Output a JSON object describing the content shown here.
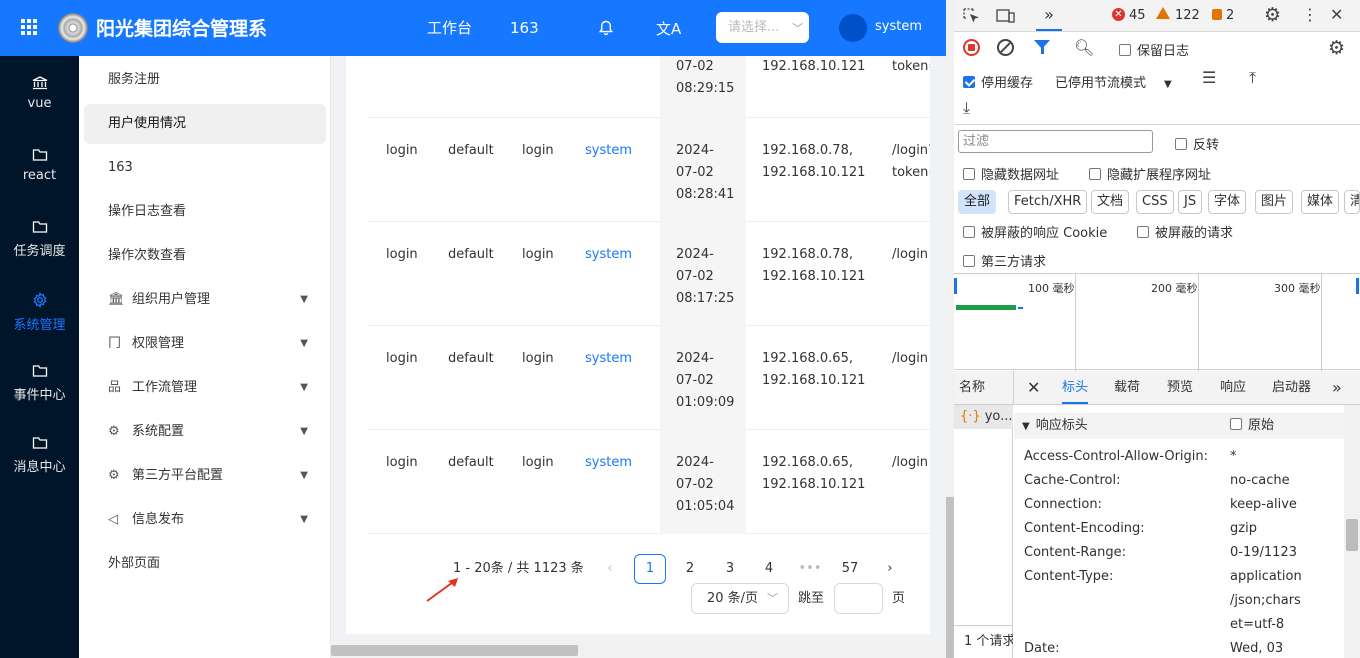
{
  "header": {
    "app_title": "阳光集团综合管理系统",
    "workspace": "工作台",
    "shortcut": "163",
    "select_placeholder": "请选择...",
    "username": "system"
  },
  "leftnav": {
    "items": [
      {
        "label": "vue",
        "icon": "bank-icon"
      },
      {
        "label": "react",
        "icon": "folder-icon"
      },
      {
        "label": "任务调度",
        "icon": "folder-icon"
      },
      {
        "label": "系统管理",
        "icon": "gear-icon"
      },
      {
        "label": "事件中心",
        "icon": "folder-icon"
      },
      {
        "label": "消息中心",
        "icon": "folder-icon"
      }
    ]
  },
  "submenu": {
    "items": [
      {
        "label": "服务注册"
      },
      {
        "label": "用户使用情况"
      },
      {
        "label": "163"
      },
      {
        "label": "操作日志查看"
      },
      {
        "label": "操作次数查看"
      },
      {
        "label": "组织用户管理",
        "icon": "bank-icon"
      },
      {
        "label": "权限管理",
        "icon": "key-icon"
      },
      {
        "label": "工作流管理",
        "icon": "flow-icon"
      },
      {
        "label": "系统配置",
        "icon": "gear-icon"
      },
      {
        "label": "第三方平台配置",
        "icon": "gear-icon"
      },
      {
        "label": "信息发布",
        "icon": "sound-icon"
      },
      {
        "label": "外部页面"
      }
    ]
  },
  "table": {
    "rows": [
      {
        "action": "",
        "tenant": "",
        "method": "",
        "user": "",
        "date": [
          "07-02",
          "08:29:15"
        ],
        "ip": [
          "192.168.10.121"
        ],
        "url": [
          "token=sy"
        ]
      },
      {
        "action": "login",
        "tenant": "default",
        "method": "login",
        "user": "system",
        "date": [
          "2024-",
          "07-02",
          "08:28:41"
        ],
        "ip": [
          "192.168.0.78,",
          "192.168.10.121"
        ],
        "url": [
          "/login?",
          "token=sy"
        ]
      },
      {
        "action": "login",
        "tenant": "default",
        "method": "login",
        "user": "system",
        "date": [
          "2024-",
          "07-02",
          "08:17:25"
        ],
        "ip": [
          "192.168.0.78,",
          "192.168.10.121"
        ],
        "url": [
          "/login"
        ]
      },
      {
        "action": "login",
        "tenant": "default",
        "method": "login",
        "user": "system",
        "date": [
          "2024-",
          "07-02",
          "01:09:09"
        ],
        "ip": [
          "192.168.0.65,",
          "192.168.10.121"
        ],
        "url": [
          "/login"
        ]
      },
      {
        "action": "login",
        "tenant": "default",
        "method": "login",
        "user": "system",
        "date": [
          "2024-",
          "07-02",
          "01:05:04"
        ],
        "ip": [
          "192.168.0.65,",
          "192.168.10.121"
        ],
        "url": [
          "/login"
        ]
      }
    ]
  },
  "pagination": {
    "summary": "1 - 20条 / 共 1123 条",
    "pages": [
      "1",
      "2",
      "3",
      "4",
      "•••",
      "57"
    ],
    "current": "1",
    "page_size": "20 条/页",
    "jump_label": "跳至",
    "page_unit": "页"
  },
  "devtools": {
    "error_count": "45",
    "warning_count": "122",
    "issue_count": "2",
    "preserve_log": "保留日志",
    "disable_cache": "停用缓存",
    "throttle": "已停用节流模式",
    "filter_placeholder": "过滤",
    "invert": "反转",
    "hide_data_urls": "隐藏数据网址",
    "hide_ext_urls": "隐藏扩展程序网址",
    "type_filters": [
      "全部",
      "Fetch/XHR",
      "文档",
      "CSS",
      "JS",
      "字体",
      "图片",
      "媒体",
      "清"
    ],
    "blocked_cookies": "被屏蔽的响应 Cookie",
    "blocked_requests": "被屏蔽的请求",
    "third_party": "第三方请求",
    "timeline_labels": [
      "100 毫秒",
      "200 毫秒",
      "300 毫秒"
    ],
    "name_col": "名称",
    "tabs": [
      "标头",
      "载荷",
      "预览",
      "响应",
      "启动器"
    ],
    "request_name": "yo...",
    "footer": "1 个请求",
    "response_headers_title": "响应标头",
    "raw_label": "原始",
    "headers": [
      {
        "key": "Access-Control-Allow-Origin:",
        "value": [
          "*"
        ]
      },
      {
        "key": "Cache-Control:",
        "value": [
          "no-cache"
        ]
      },
      {
        "key": "Connection:",
        "value": [
          "keep-alive"
        ]
      },
      {
        "key": "Content-Encoding:",
        "value": [
          "gzip"
        ]
      },
      {
        "key": "Content-Range:",
        "value": [
          "0-19/1123"
        ]
      },
      {
        "key": "Content-Type:",
        "value": [
          "application",
          "/json;chars",
          "et=utf-8"
        ]
      },
      {
        "key": "Date:",
        "value": [
          "Wed, 03"
        ]
      }
    ]
  },
  "colors": {
    "primary": "#1677ff",
    "sidebar": "#001529",
    "devtools_accent": "#1a73e8",
    "arrow": "#e8311a"
  }
}
